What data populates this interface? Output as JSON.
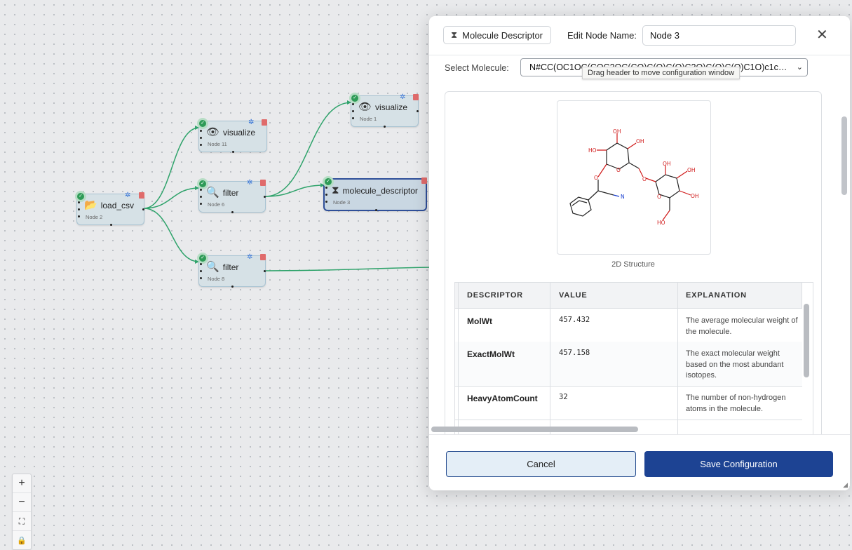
{
  "nodes": [
    {
      "id": "n2",
      "label": "load_csv",
      "sub": "Node 2",
      "icon": "folder-icon",
      "glyph": "📂"
    },
    {
      "id": "n11",
      "label": "visualize",
      "sub": "Node 11",
      "icon": "eye-icon",
      "glyph": "👁"
    },
    {
      "id": "n6",
      "label": "filter",
      "sub": "Node 6",
      "icon": "magnifier-icon",
      "glyph": "🔍"
    },
    {
      "id": "n8",
      "label": "filter",
      "sub": "Node 8",
      "icon": "magnifier-icon",
      "glyph": "🔍"
    },
    {
      "id": "n1",
      "label": "visualize",
      "sub": "Node 1",
      "icon": "eye-icon",
      "glyph": "👁"
    },
    {
      "id": "n3",
      "label": "molecule_descriptor",
      "sub": "Node 3",
      "icon": "hourglass-icon",
      "glyph": "⧗"
    }
  ],
  "zoom_controls": {
    "zoom_in": "+",
    "zoom_out": "−",
    "fit": "⛶",
    "lock": "🔒"
  },
  "panel": {
    "node_type": "Molecule Descriptor",
    "type_glyph": "⧗",
    "name_label": "Edit Node Name:",
    "name_value": "Node 3",
    "close_glyph": "✕",
    "molecule_label": "Select Molecule:",
    "molecule_value": "N#CC(OC1OC(COC2OC(CO)C(O)C(O)C2O)C(O)C(O)C1O)c1ccc...",
    "tooltip": "Drag header to move configuration window",
    "structure_caption": "2D Structure",
    "table": {
      "headers": [
        "DESCRIPTOR",
        "VALUE",
        "EXPLANATION"
      ],
      "rows": [
        {
          "descriptor": "MolWt",
          "value": "457.432",
          "explanation": "The average molecular weight of the molecule."
        },
        {
          "descriptor": "ExactMolWt",
          "value": "457.158",
          "explanation": "The exact molecular weight based on the most abundant isotopes."
        },
        {
          "descriptor": "HeavyAtomCount",
          "value": "32",
          "explanation": "The number of non-hydrogen atoms in the molecule."
        }
      ]
    },
    "cancel_label": "Cancel",
    "save_label": "Save Configuration"
  },
  "colors": {
    "edge": "#2fa36b",
    "primary": "#1d4393",
    "node_bg": "#d6e1e6",
    "success": "#2e9b57",
    "danger": "#e06b6b",
    "gear": "#2f6fd6",
    "atom_o": "#d01818",
    "atom_n": "#1a3fd0"
  }
}
